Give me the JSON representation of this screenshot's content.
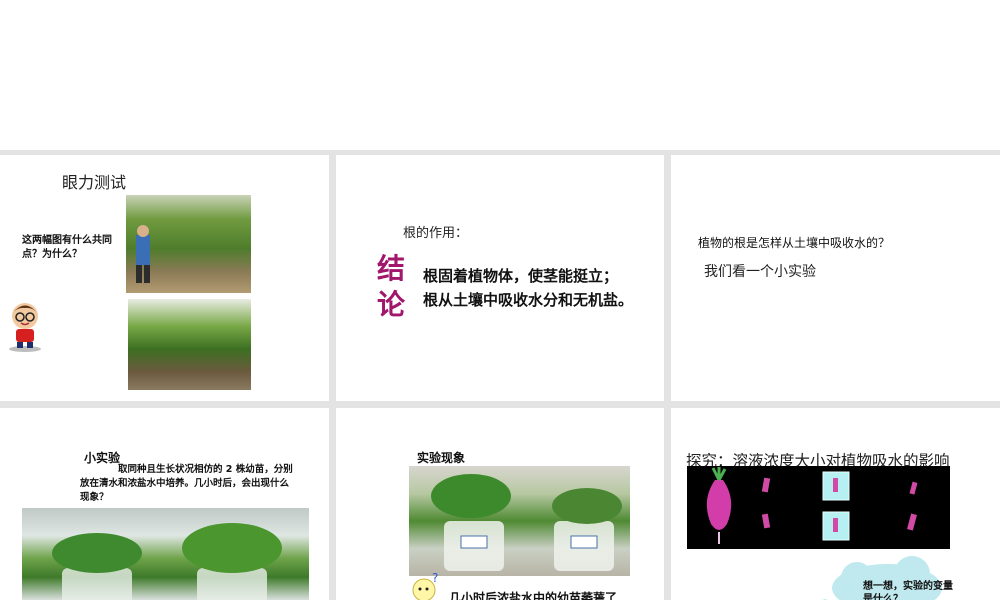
{
  "slides": {
    "s1": {
      "title": "眼力测试",
      "question": "这两幅图有什么共同点？为什么？"
    },
    "s2": {
      "lead": "根的作用：",
      "big_char_1": "结",
      "big_char_2": "论",
      "line_1": "根固着植物体，使茎能挺立；",
      "line_2": "根从土壤中吸收水分和无机盐。"
    },
    "s3": {
      "question": "植物的根是怎样从土壤中吸收水的？",
      "sub": "我们看一个小实验"
    },
    "s4": {
      "title": "小实验",
      "paragraph": "取同种且生长状况相仿的 2 株幼苗，分别放在清水和浓盐水中培养。几小时后，会出现什么现象？"
    },
    "s5": {
      "title": "实验现象",
      "caption": "几小时后浓盐水中的幼苗萎蔫了"
    },
    "s6": {
      "title": "探究：溶液浓度大小对植物吸水的影响",
      "cloud": "想一想，实验的变量是什么？"
    }
  },
  "icons": {
    "cartoon": "cartoon-boy-icon",
    "bulb": "lightbulb-character-icon"
  },
  "colors": {
    "accent": "#a0176b",
    "background": "#e3e3e3"
  }
}
